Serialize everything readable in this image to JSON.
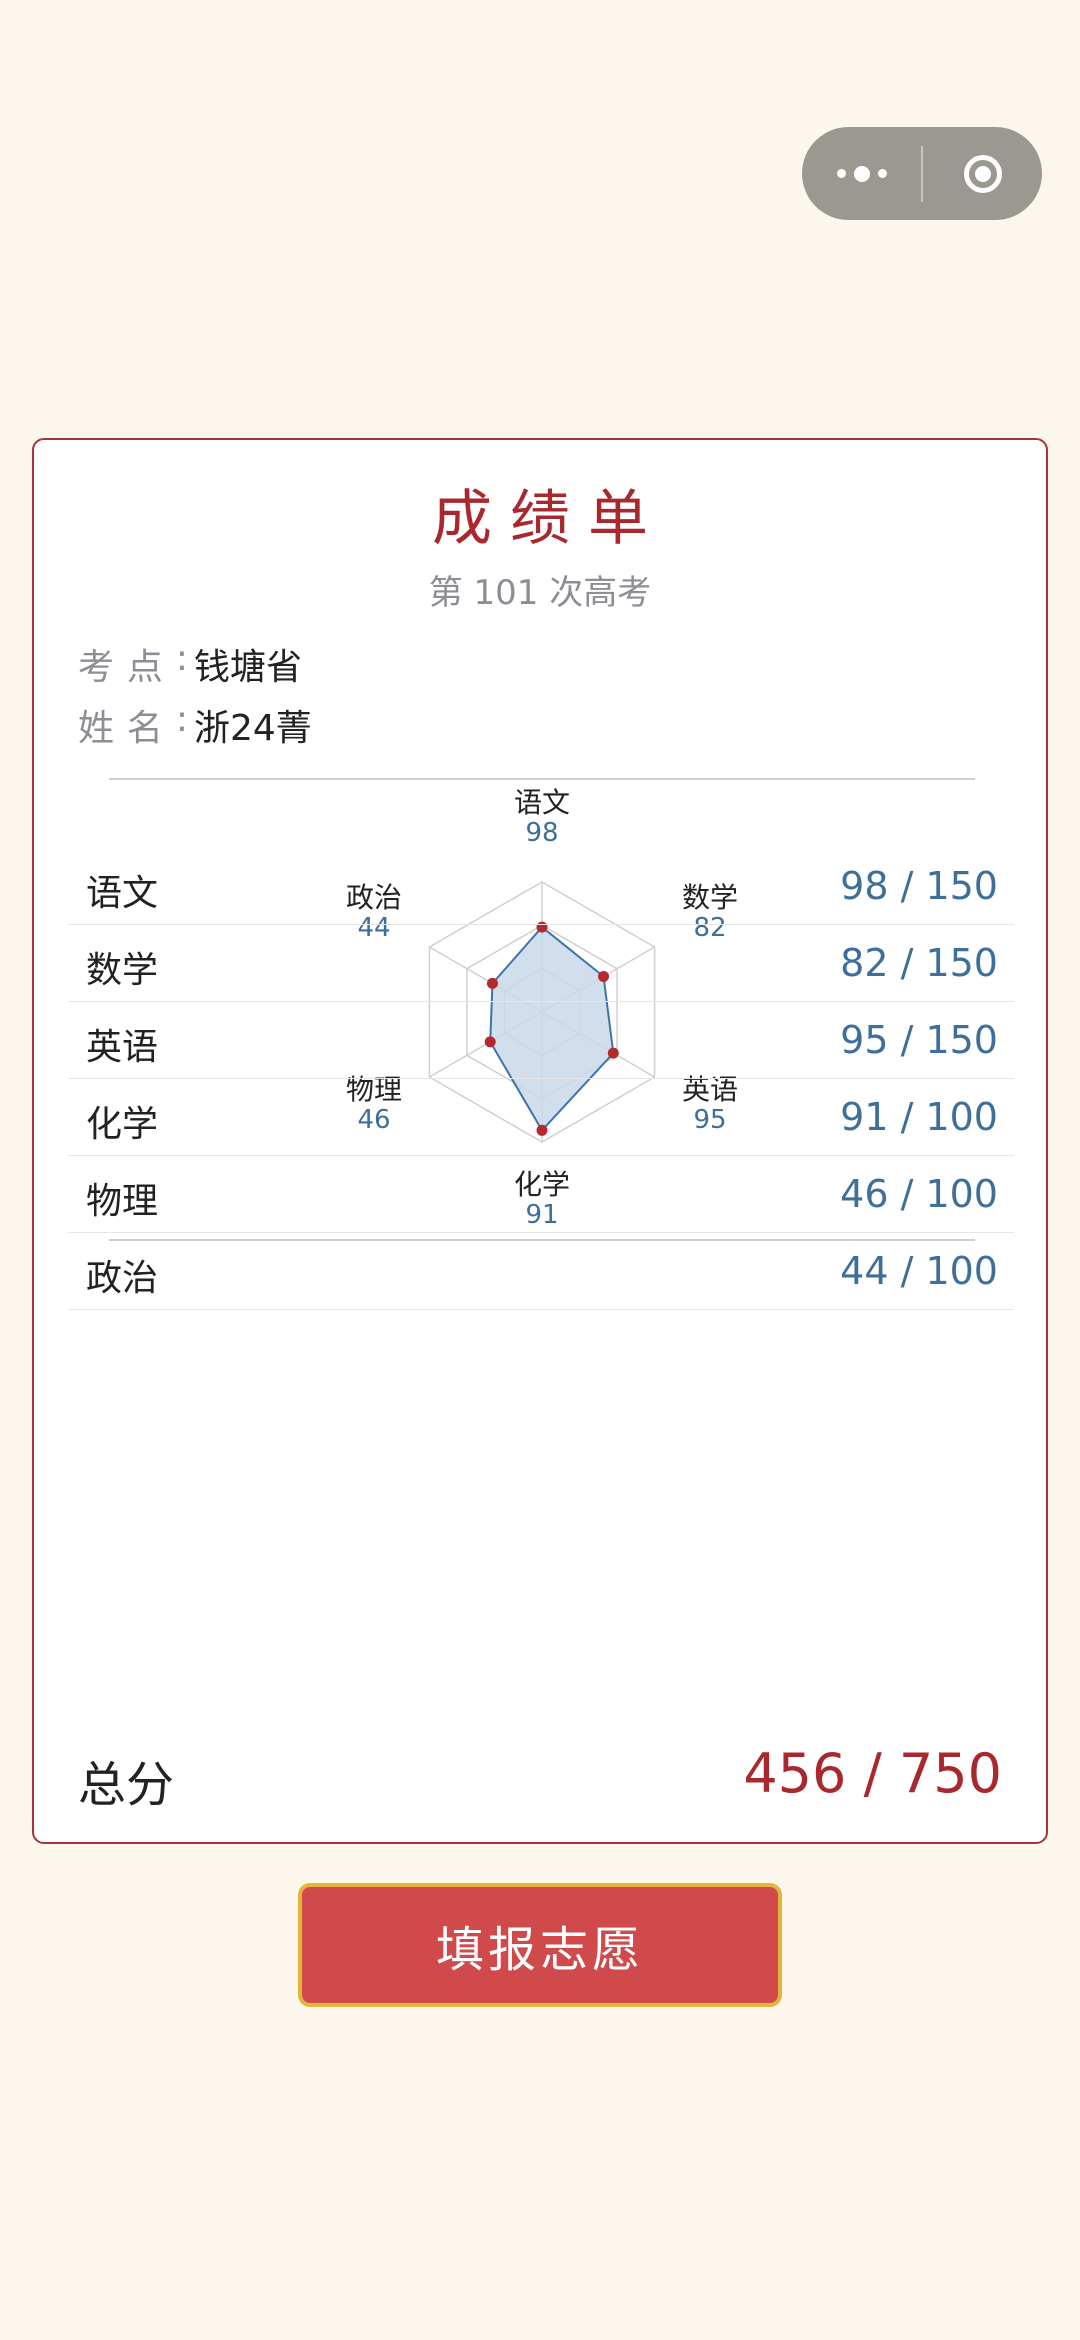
{
  "header": {
    "capsule": {
      "more_icon": "more-dots-icon",
      "close_icon": "close-circle-icon"
    }
  },
  "card": {
    "title": "成绩单",
    "subtitle": "第 101 次高考",
    "info": [
      {
        "label_a": "考",
        "label_b": "点",
        "colon": ":",
        "value": "钱塘省"
      },
      {
        "label_a": "姓",
        "label_b": "名",
        "colon": ":",
        "value": "浙24菁"
      }
    ]
  },
  "radar": {
    "axes": [
      {
        "name": "语文",
        "value": 98,
        "max": 150
      },
      {
        "name": "数学",
        "value": 82,
        "max": 150
      },
      {
        "name": "英语",
        "value": 95,
        "max": 150
      },
      {
        "name": "化学",
        "value": 91,
        "max": 100
      },
      {
        "name": "物理",
        "value": 46,
        "max": 100
      },
      {
        "name": "政治",
        "value": 44,
        "max": 100
      }
    ],
    "fill_color": "#c9d9ea",
    "line_color": "#3d73ad",
    "point_color": "#b3292e"
  },
  "scores": [
    {
      "subject": "语文",
      "score": "98 / 150"
    },
    {
      "subject": "数学",
      "score": "82 / 150"
    },
    {
      "subject": "英语",
      "score": "95 / 150"
    },
    {
      "subject": "化学",
      "score": "91 / 100"
    },
    {
      "subject": "物理",
      "score": "46 / 100"
    },
    {
      "subject": "政治",
      "score": "44 / 100"
    }
  ],
  "total": {
    "label": "总分",
    "value": "456 / 750"
  },
  "action": {
    "button_label": "填报志愿"
  },
  "colors": {
    "background": "#fbf7ec",
    "accent_red": "#a8282d",
    "score_blue": "#3d6f9a",
    "button_red": "#d14a4b",
    "button_border": "#e3b53d"
  }
}
